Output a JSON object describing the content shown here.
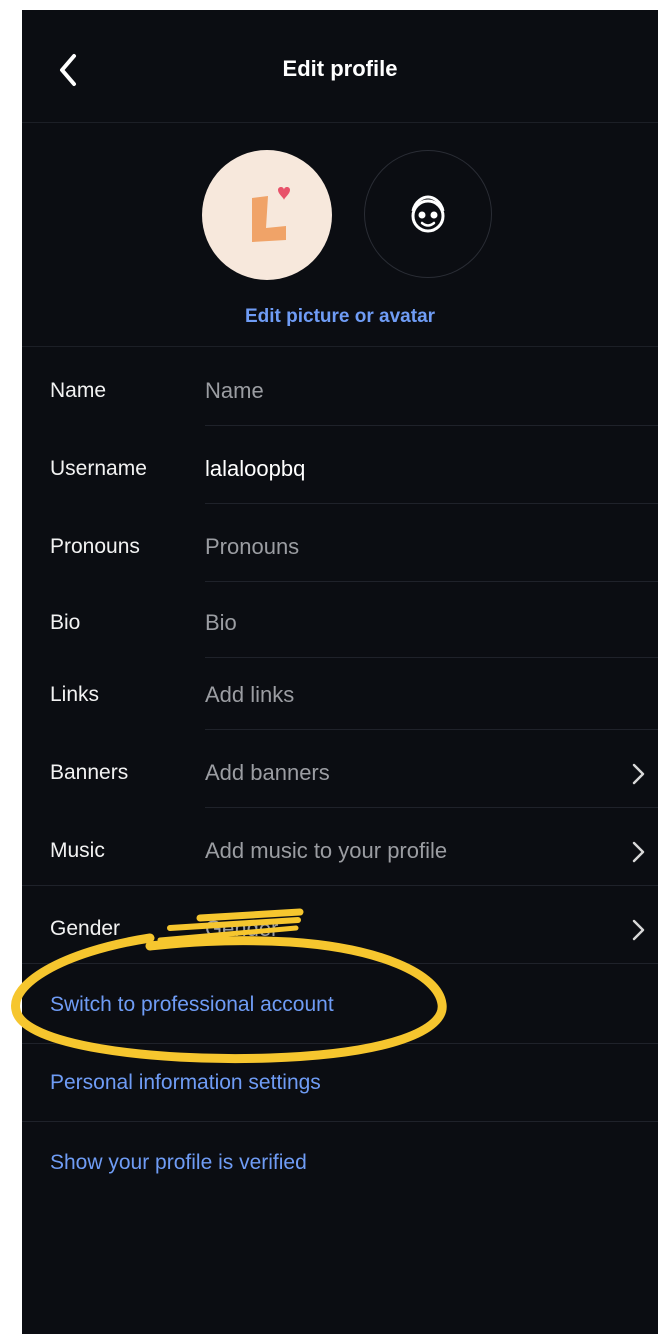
{
  "header": {
    "title": "Edit profile"
  },
  "avatar": {
    "edit_label": "Edit picture or avatar",
    "photo_letter": "L"
  },
  "fields": [
    {
      "label": "Name",
      "value": "Name",
      "filled": false
    },
    {
      "label": "Username",
      "value": "lalaloopbq",
      "filled": true
    },
    {
      "label": "Pronouns",
      "value": "Pronouns",
      "filled": false
    },
    {
      "label": "Bio",
      "value": "Bio",
      "filled": false
    },
    {
      "label": "Links",
      "value": "Add links",
      "filled": false
    },
    {
      "label": "Banners",
      "value": "Add banners",
      "filled": false
    },
    {
      "label": "Music",
      "value": "Add music to your profile",
      "filled": false
    },
    {
      "label": "Gender",
      "value": "Gender",
      "filled": false
    }
  ],
  "links": [
    {
      "text": "Switch to professional account"
    },
    {
      "text": "Personal information settings"
    },
    {
      "text": "Show your profile is verified"
    }
  ],
  "colors": {
    "background": "#0b0d12",
    "link": "#6f9cf5",
    "annotation": "#f6c62e",
    "avatar_bg": "#f7e8dc"
  }
}
